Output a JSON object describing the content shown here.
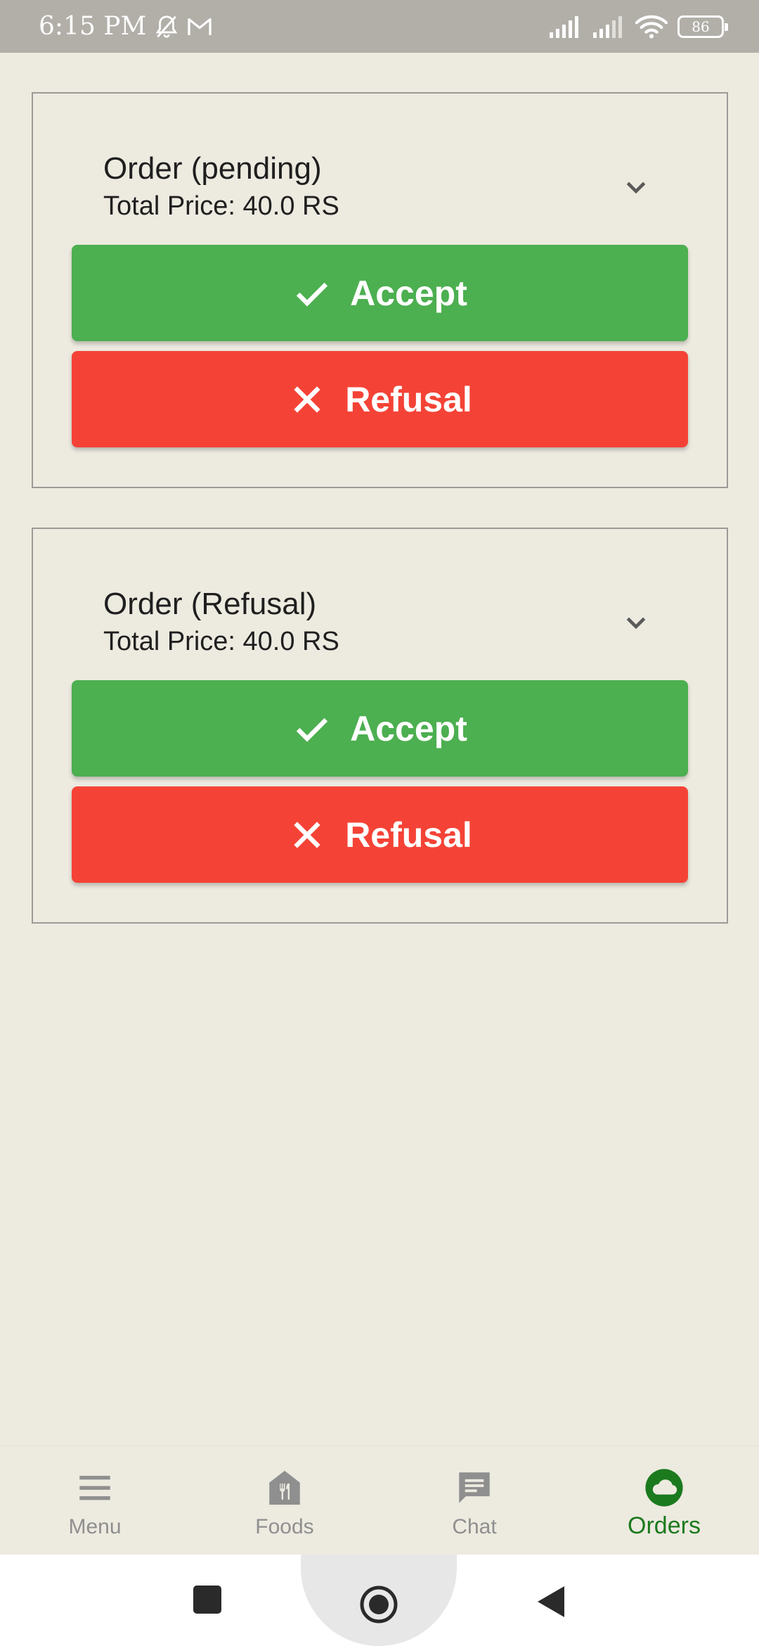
{
  "status_bar": {
    "time": "6:15 PM",
    "battery": "86"
  },
  "orders": [
    {
      "title": "Order (pending)",
      "total_price": "Total Price: 40.0 RS",
      "accept_label": "Accept",
      "refusal_label": "Refusal"
    },
    {
      "title": "Order (Refusal)",
      "total_price": "Total Price: 40.0 RS",
      "accept_label": "Accept",
      "refusal_label": "Refusal"
    }
  ],
  "bottom_nav": {
    "items": [
      {
        "label": "Menu",
        "icon": "menu-icon"
      },
      {
        "label": "Foods",
        "icon": "restaurant-icon"
      },
      {
        "label": "Chat",
        "icon": "chat-icon"
      },
      {
        "label": "Orders",
        "icon": "cloud-icon",
        "active": true
      }
    ]
  },
  "colors": {
    "background": "#EDEAE0",
    "accept": "#4CAF50",
    "refusal": "#F44336",
    "active_nav": "#1B7A1E",
    "inactive_nav": "#8F8F8F"
  }
}
